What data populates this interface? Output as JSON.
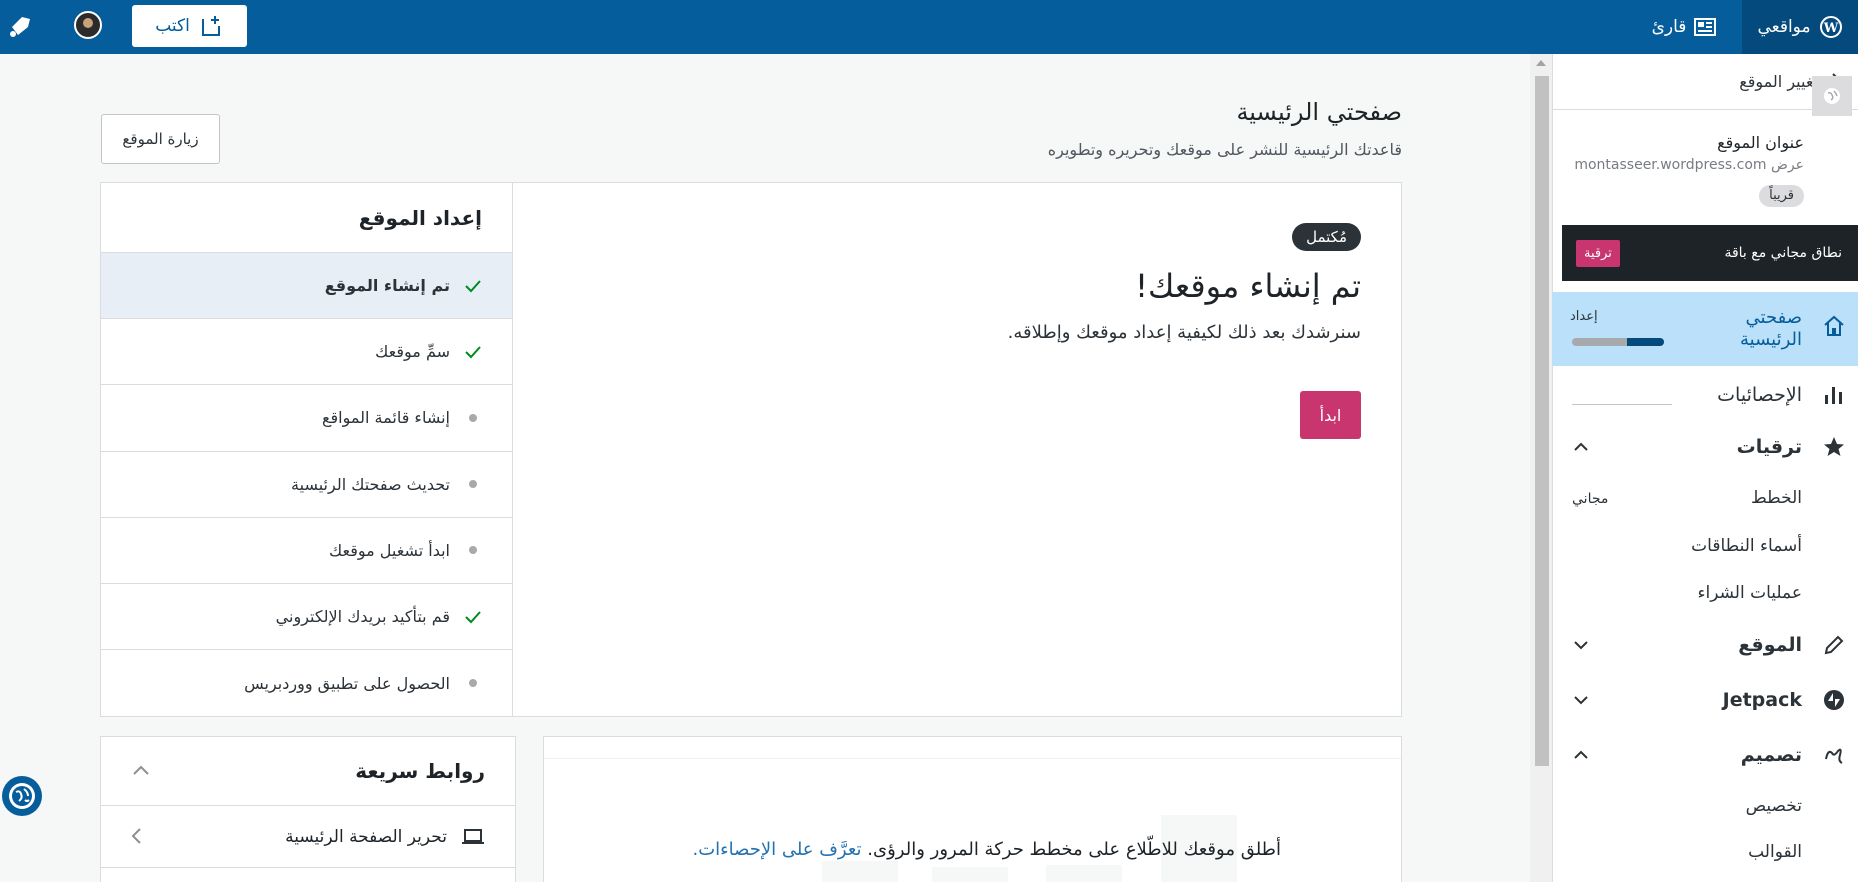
{
  "masterbar": {
    "my_sites": "مواقعي",
    "reader": "قارئ",
    "write": "اكتب"
  },
  "sidebar": {
    "switch_site": "تغيير الموقع",
    "site_title": "عنوان الموقع",
    "site_url": "montasseer.wordpress.com عرض",
    "coming_soon": "قريباً",
    "upsell_text": "نطاق مجاني مع باقة",
    "upsell_button": "ترقية",
    "home": "صفحتي الرئيسية",
    "home_setup": "إعداد",
    "setup_progress": 0.4,
    "stats": "الإحصائيات",
    "upgrades": "ترقيات",
    "plans": "الخطط",
    "plans_badge": "مجاني",
    "domains": "أسماء النطاقات",
    "purchases": "عمليات الشراء",
    "site": "الموقع",
    "jetpack": "Jetpack",
    "design": "تصميم",
    "customize": "تخصيص",
    "themes": "القوالب"
  },
  "main": {
    "title": "صفحتي الرئيسية",
    "subtitle": "قاعدتك الرئيسية للنشر على موقعك وتحريره وتطويره",
    "visit_site": "زيارة الموقع"
  },
  "setup": {
    "title": "إعداد الموقع",
    "tasks": [
      {
        "label": "تم إنشاء الموقع",
        "done": true
      },
      {
        "label": "سمِّ موقعك",
        "done": true
      },
      {
        "label": "إنشاء قائمة المواقع",
        "done": false
      },
      {
        "label": "تحديث صفحتك الرئيسية",
        "done": false
      },
      {
        "label": "ابدأ تشغيل موقعك",
        "done": false
      },
      {
        "label": "قم بتأكيد بريدك الإلكتروني",
        "done": true
      },
      {
        "label": "الحصول على تطبيق ووردبريس",
        "done": false
      }
    ],
    "badge": "مُكتمل",
    "detail_title": "تم إنشاء موقعك!",
    "detail_text": "سنرشدك بعد ذلك لكيفية إعداد موقعك وإطلاقه.",
    "start_button": "ابدأ"
  },
  "quick_links": {
    "title": "روابط سريعة",
    "edit_homepage": "تحرير الصفحة الرئيسية"
  },
  "stats": {
    "text": "أطلق موقعك للاطّلاع على مخطط حركة المرور والرؤى.",
    "link": "تعرَّف على الإحصاءات."
  },
  "colors": {
    "masterbar": "#055d9c",
    "accent_pink": "#c9356e",
    "highlight": "#bbe0fa",
    "check_green": "#008a20"
  }
}
